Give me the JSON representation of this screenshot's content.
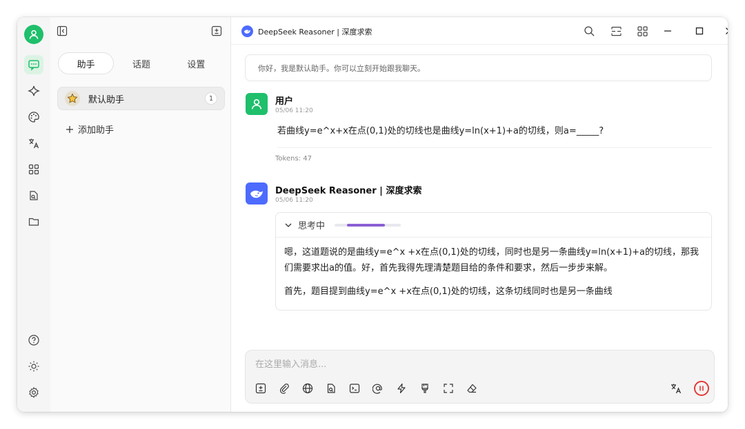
{
  "app": {
    "model_title": "DeepSeek Reasoner | 深度求索"
  },
  "sidebar": {
    "tabs": [
      {
        "label": "助手",
        "active": true
      },
      {
        "label": "话题",
        "active": false
      },
      {
        "label": "设置",
        "active": false
      }
    ],
    "assistants": [
      {
        "name": "默认助手",
        "count": "1",
        "icon": "star-emoji"
      }
    ],
    "add_assistant_label": "添加助手"
  },
  "rail": {
    "items": [
      "chat-icon",
      "sparkle-icon",
      "palette-icon",
      "translate-icon",
      "apps-grid-icon",
      "file-search-icon",
      "folder-icon"
    ],
    "bottom": [
      "help-icon",
      "theme-sun-icon",
      "settings-icon"
    ]
  },
  "chat": {
    "greeting": "你好，我是默认助手。你可以立刻开始跟我聊天。",
    "messages": [
      {
        "role": "user",
        "name": "用户",
        "time": "05/06 11:20",
        "text": "若曲线y=e^x+x在点(0,1)处的切线也是曲线y=ln(x+1)+a的切线，则a=_____?",
        "tokens": "Tokens: 47"
      },
      {
        "role": "assistant",
        "name": "DeepSeek Reasoner | 深度求索",
        "time": "05/06 11:20",
        "thinking_label": "思考中",
        "thinking_progress": 0.55,
        "thinking_paragraphs": [
          "嗯，这道题说的是曲线y=e^x +x在点(0,1)处的切线，同时也是另一条曲线y=ln(x+1)+a的切线，那我们需要求出a的值。好，首先我得先理清楚题目给的条件和要求，然后一步步来解。",
          "首先，题目提到曲线y=e^x +x在点(0,1)处的切线，这条切线同时也是另一条曲线"
        ]
      }
    ]
  },
  "composer": {
    "placeholder": "在这里输入消息..."
  },
  "colors": {
    "accent_green": "#1fbf6b",
    "deepseek_blue": "#4d6bfe",
    "thinking_purple": "#8b5fd4",
    "stop_red": "#e53935"
  }
}
